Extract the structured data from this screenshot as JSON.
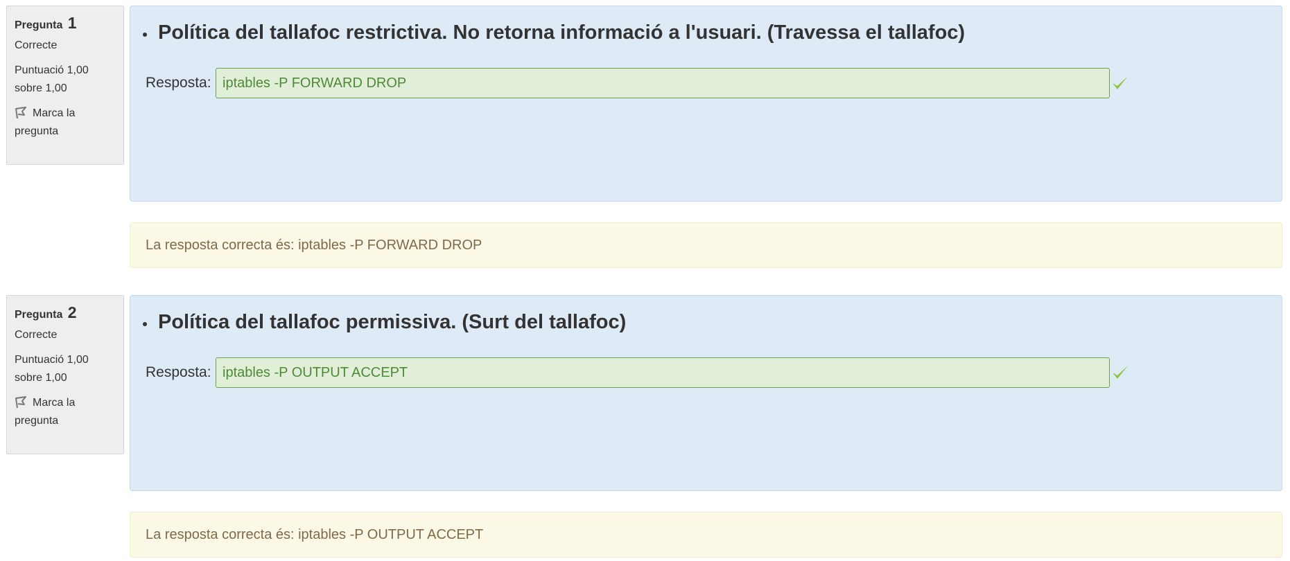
{
  "questions": [
    {
      "label": "Pregunta",
      "number": "1",
      "state": "Correcte",
      "grade_line1": "Puntuació 1,00",
      "grade_line2": "sobre 1,00",
      "flag_line1": "Marca la",
      "flag_line2": "pregunta",
      "text": "Política del tallafoc restrictiva. No retorna informació a l'usuari. (Travessa el tallafoc)",
      "answer_label": "Resposta:",
      "answer_value": "iptables -P FORWARD DROP",
      "feedback": "La resposta correcta és: iptables -P FORWARD DROP",
      "status_icon": "check-icon"
    },
    {
      "label": "Pregunta",
      "number": "2",
      "state": "Correcte",
      "grade_line1": "Puntuació 1,00",
      "grade_line2": "sobre 1,00",
      "flag_line1": "Marca la",
      "flag_line2": "pregunta",
      "text": "Política del tallafoc permissiva. (Surt del tallafoc)",
      "answer_label": "Resposta:",
      "answer_value": "iptables -P OUTPUT ACCEPT",
      "feedback": "La resposta correcta és: iptables -P OUTPUT ACCEPT",
      "status_icon": "check-icon"
    }
  ],
  "colors": {
    "question_bg": "#deeaf6",
    "info_bg": "#eeeeee",
    "correct_input_bg": "#e1efd9",
    "correct_text": "#4d8a35",
    "check": "#8cc63f",
    "feedback_bg": "#fbf8e6",
    "feedback_text": "#7d6a4a"
  }
}
